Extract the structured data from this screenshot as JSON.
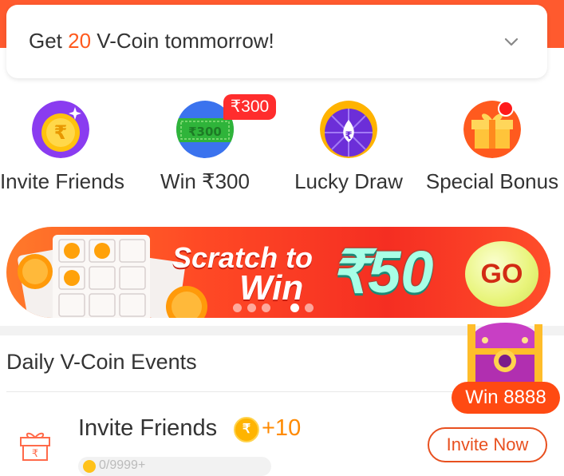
{
  "coin_notice": {
    "prefix": "Get ",
    "amount": "20",
    "suffix": " V-Coin tommorrow!"
  },
  "quick_actions": [
    {
      "label": "Invite Friends",
      "icon": "invite-friends-icon"
    },
    {
      "label": "Win ₹300",
      "icon": "cash-note-icon",
      "badge": "₹300",
      "note_text": "₹300"
    },
    {
      "label": "Lucky Draw",
      "icon": "lucky-draw-wheel-icon"
    },
    {
      "label": "Special Bonus",
      "icon": "gift-box-icon"
    }
  ],
  "banner": {
    "title_line1": "Scratch to",
    "title_line2": "Win",
    "amount": "₹50",
    "button_label": "GO",
    "page_count": 5,
    "active_page": 4
  },
  "events_section": {
    "title": "Daily V-Coin Events",
    "chest_label": "Win 8888"
  },
  "event_item": {
    "title": "Invite Friends",
    "reward": "+10",
    "button_label": "Invite Now",
    "progress_text": "0/9999+"
  },
  "colors": {
    "accent": "#ff5a2e",
    "reward": "#ff8a00",
    "banner_amount": "#a8ffe6"
  }
}
